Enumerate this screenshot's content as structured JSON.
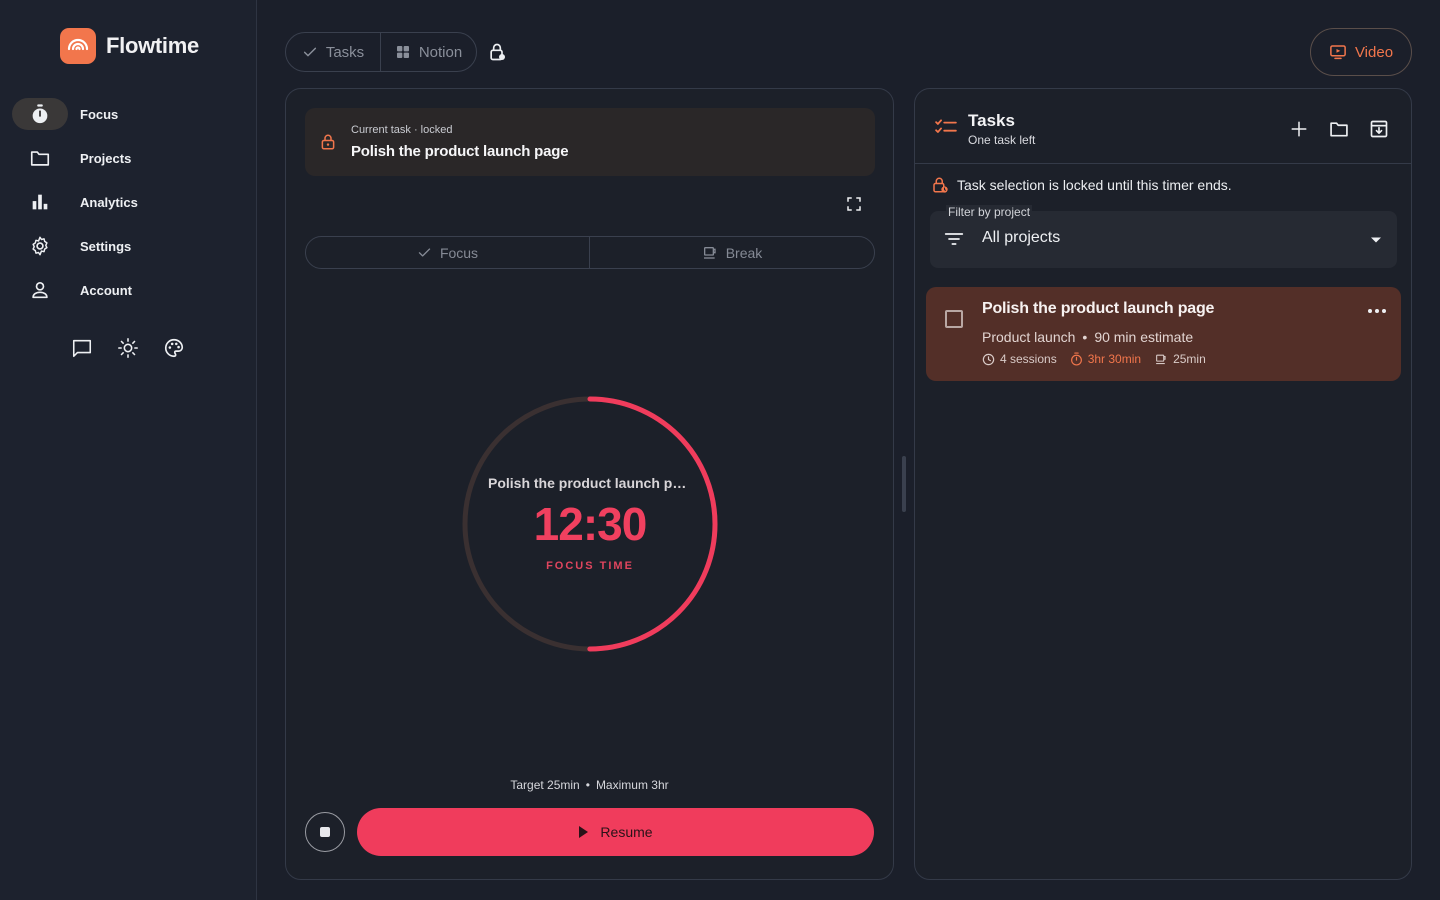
{
  "app": {
    "name": "Flowtime"
  },
  "sidebar": {
    "items": [
      {
        "label": "Focus",
        "icon": "stopwatch-icon",
        "active": true
      },
      {
        "label": "Projects",
        "icon": "folder-icon"
      },
      {
        "label": "Analytics",
        "icon": "bar-chart-icon"
      },
      {
        "label": "Settings",
        "icon": "gear-icon"
      },
      {
        "label": "Account",
        "icon": "person-icon"
      }
    ],
    "utilities": [
      "feedback-icon",
      "brightness-icon",
      "palette-icon"
    ]
  },
  "topbar": {
    "tabs": [
      {
        "label": "Tasks",
        "icon": "check-icon"
      },
      {
        "label": "Notion",
        "icon": "grid-icon"
      }
    ],
    "video_label": "Video"
  },
  "timer": {
    "current_task_kicker": "Current task · locked",
    "current_task_title": "Polish the product launch page",
    "modes": [
      {
        "label": "Focus"
      },
      {
        "label": "Break"
      }
    ],
    "ring_task": "Polish the product launch page",
    "time": "12:30",
    "label": "FOCUS TIME",
    "progress": 0.5,
    "target_text": "Target 25min",
    "separator": "•",
    "maximum_text": "Maximum 3hr",
    "resume_label": "Resume"
  },
  "tasks_panel": {
    "title": "Tasks",
    "subtitle": "One task left",
    "lock_notice": "Task selection is locked until this timer ends.",
    "filter_label": "Filter by project",
    "filter_value": "All projects",
    "items": [
      {
        "title": "Polish the product launch page",
        "project": "Product launch",
        "separator": "•",
        "estimate": "90 min estimate",
        "sessions": "4 sessions",
        "focus_time": "3hr 30min",
        "break_time": "25min"
      }
    ]
  },
  "colors": {
    "accent": "#f2764c",
    "timer_red": "#f03c5c",
    "background": "#1b1f2a",
    "task_card": "#532f28"
  }
}
